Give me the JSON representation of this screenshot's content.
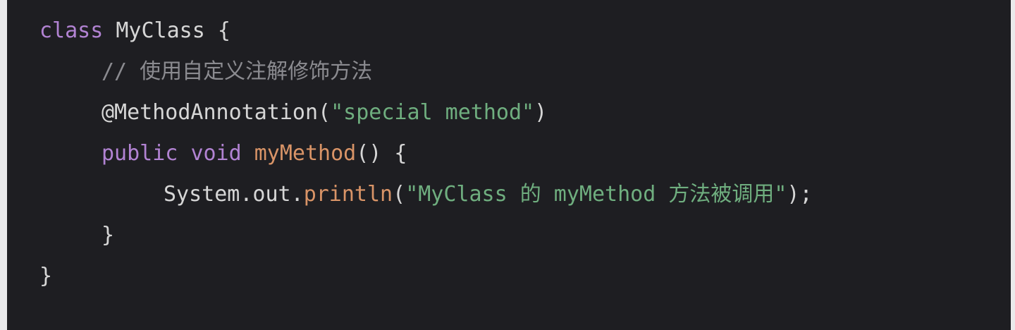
{
  "code": {
    "line1": {
      "keyword": "class",
      "space": " ",
      "name": "MyClass",
      "brace": " {"
    },
    "line2": {
      "comment": "// 使用自定义注解修饰方法"
    },
    "line3": {
      "annotation": "@MethodAnnotation(",
      "string": "\"special method\"",
      "close": ")"
    },
    "line4": {
      "kw1": "public",
      "sp1": " ",
      "kw2": "void",
      "sp2": " ",
      "method": "myMethod",
      "rest": "() {"
    },
    "line5": {
      "prefix": "System.out.",
      "call": "println",
      "open": "(",
      "string": "\"MyClass 的 myMethod 方法被调用\"",
      "close": ");"
    },
    "line6": {
      "brace": "}"
    },
    "line7": {
      "brace": "}"
    }
  },
  "colors": {
    "background": "#1e1e22",
    "keyword": "#b283d3",
    "plain": "#d6d6d6",
    "comment": "#8b8b90",
    "string": "#6fae7f",
    "function": "#d99467"
  }
}
